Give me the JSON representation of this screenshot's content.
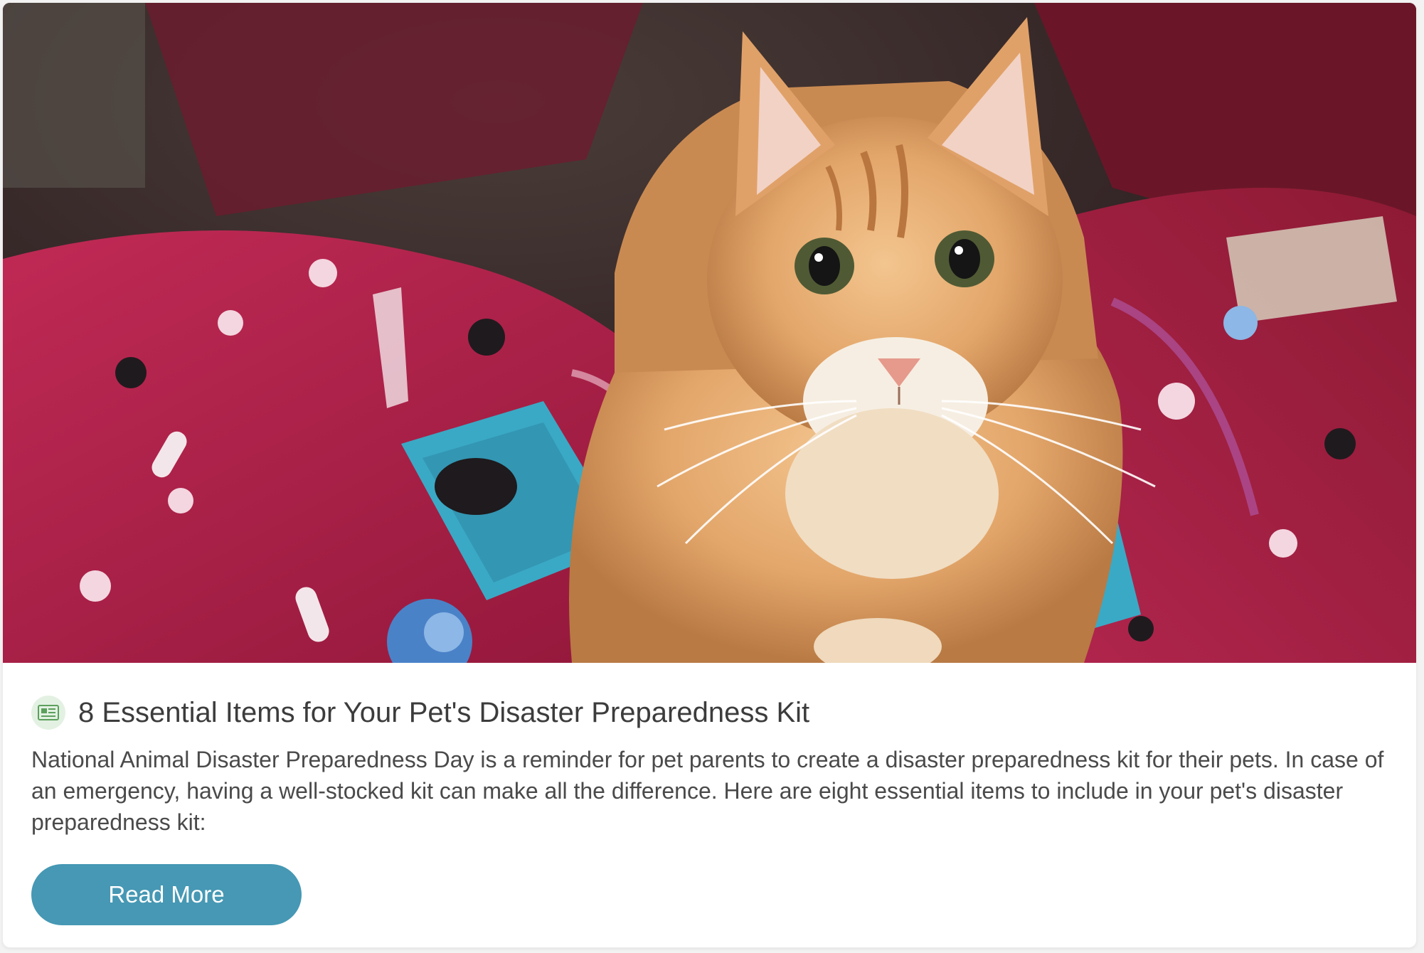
{
  "article": {
    "title": "8 Essential Items for Your Pet's Disaster Preparedness Kit",
    "description": "National Animal Disaster Preparedness Day is a reminder for pet parents to create a disaster preparedness kit for their pets. In case of an emergency, having a well-stocked kit can make all the difference. Here are eight essential items to include in your pet's disaster preparedness kit:",
    "category_icon": "newspaper-icon",
    "read_more_label": "Read More"
  },
  "colors": {
    "accent": "#4698b4",
    "icon_badge": "#e3f1e3",
    "title_text": "#3c3c3c",
    "body_text": "#4a4a4a"
  }
}
